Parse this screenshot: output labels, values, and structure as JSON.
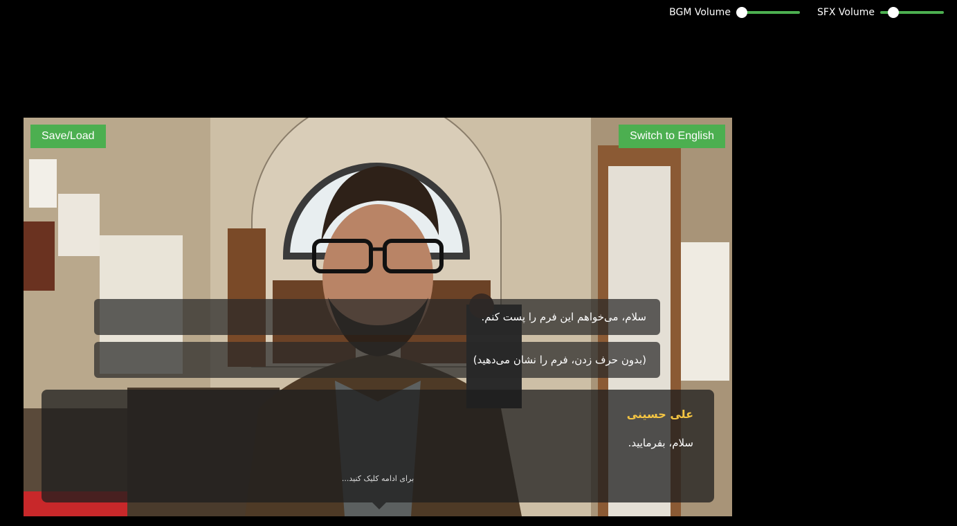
{
  "volume": {
    "bgm_label": "BGM Volume",
    "bgm_level": 0.0,
    "sfx_label": "SFX Volume",
    "sfx_level": 0.15
  },
  "toolbar": {
    "save_load_label": "Save/Load",
    "language_label": "Switch to English"
  },
  "choices": [
    {
      "text": "سلام، می‌خواهم این فرم را پست کنم."
    },
    {
      "text": "(بدون حرف زدن، فرم را نشان می‌دهید)"
    }
  ],
  "dialog": {
    "speaker": "علی حسینی",
    "line": "سلام، بفرمایید.",
    "continue_hint": "برای ادامه کلیک کنید..."
  },
  "colors": {
    "accent": "#4caf50",
    "speaker": "#f5c542"
  }
}
